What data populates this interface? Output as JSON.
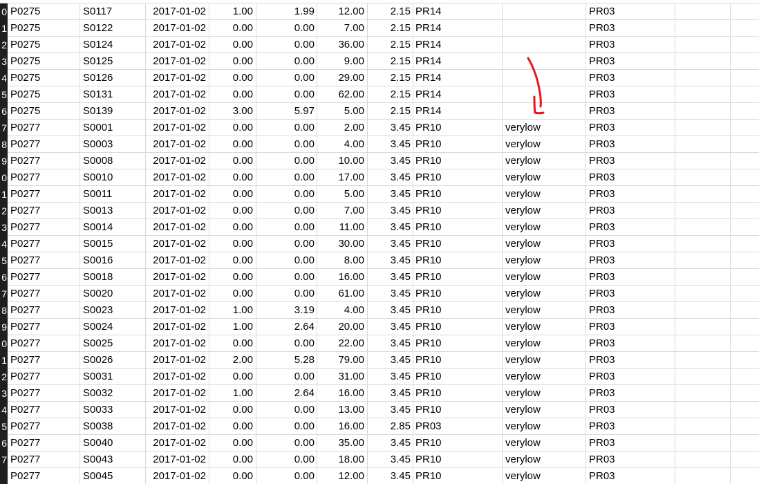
{
  "rows": [
    {
      "num": "0",
      "product": "P0275",
      "store": "S0117",
      "date": "2017-01-02",
      "qty": "1.00",
      "revenue": "1.99",
      "stock": "12.00",
      "price": "2.15",
      "promo": "PR14",
      "level": "",
      "group": "PR03"
    },
    {
      "num": "1",
      "product": "P0275",
      "store": "S0122",
      "date": "2017-01-02",
      "qty": "0.00",
      "revenue": "0.00",
      "stock": "7.00",
      "price": "2.15",
      "promo": "PR14",
      "level": "",
      "group": "PR03"
    },
    {
      "num": "2",
      "product": "P0275",
      "store": "S0124",
      "date": "2017-01-02",
      "qty": "0.00",
      "revenue": "0.00",
      "stock": "36.00",
      "price": "2.15",
      "promo": "PR14",
      "level": "",
      "group": "PR03"
    },
    {
      "num": "3",
      "product": "P0275",
      "store": "S0125",
      "date": "2017-01-02",
      "qty": "0.00",
      "revenue": "0.00",
      "stock": "9.00",
      "price": "2.15",
      "promo": "PR14",
      "level": "",
      "group": "PR03"
    },
    {
      "num": "4",
      "product": "P0275",
      "store": "S0126",
      "date": "2017-01-02",
      "qty": "0.00",
      "revenue": "0.00",
      "stock": "29.00",
      "price": "2.15",
      "promo": "PR14",
      "level": "",
      "group": "PR03"
    },
    {
      "num": "5",
      "product": "P0275",
      "store": "S0131",
      "date": "2017-01-02",
      "qty": "0.00",
      "revenue": "0.00",
      "stock": "62.00",
      "price": "2.15",
      "promo": "PR14",
      "level": "",
      "group": "PR03"
    },
    {
      "num": "6",
      "product": "P0275",
      "store": "S0139",
      "date": "2017-01-02",
      "qty": "3.00",
      "revenue": "5.97",
      "stock": "5.00",
      "price": "2.15",
      "promo": "PR14",
      "level": "",
      "group": "PR03"
    },
    {
      "num": "7",
      "product": "P0277",
      "store": "S0001",
      "date": "2017-01-02",
      "qty": "0.00",
      "revenue": "0.00",
      "stock": "2.00",
      "price": "3.45",
      "promo": "PR10",
      "level": "verylow",
      "group": "PR03"
    },
    {
      "num": "8",
      "product": "P0277",
      "store": "S0003",
      "date": "2017-01-02",
      "qty": "0.00",
      "revenue": "0.00",
      "stock": "4.00",
      "price": "3.45",
      "promo": "PR10",
      "level": "verylow",
      "group": "PR03"
    },
    {
      "num": "9",
      "product": "P0277",
      "store": "S0008",
      "date": "2017-01-02",
      "qty": "0.00",
      "revenue": "0.00",
      "stock": "10.00",
      "price": "3.45",
      "promo": "PR10",
      "level": "verylow",
      "group": "PR03"
    },
    {
      "num": "0",
      "product": "P0277",
      "store": "S0010",
      "date": "2017-01-02",
      "qty": "0.00",
      "revenue": "0.00",
      "stock": "17.00",
      "price": "3.45",
      "promo": "PR10",
      "level": "verylow",
      "group": "PR03"
    },
    {
      "num": "1",
      "product": "P0277",
      "store": "S0011",
      "date": "2017-01-02",
      "qty": "0.00",
      "revenue": "0.00",
      "stock": "5.00",
      "price": "3.45",
      "promo": "PR10",
      "level": "verylow",
      "group": "PR03"
    },
    {
      "num": "2",
      "product": "P0277",
      "store": "S0013",
      "date": "2017-01-02",
      "qty": "0.00",
      "revenue": "0.00",
      "stock": "7.00",
      "price": "3.45",
      "promo": "PR10",
      "level": "verylow",
      "group": "PR03"
    },
    {
      "num": "3",
      "product": "P0277",
      "store": "S0014",
      "date": "2017-01-02",
      "qty": "0.00",
      "revenue": "0.00",
      "stock": "11.00",
      "price": "3.45",
      "promo": "PR10",
      "level": "verylow",
      "group": "PR03"
    },
    {
      "num": "4",
      "product": "P0277",
      "store": "S0015",
      "date": "2017-01-02",
      "qty": "0.00",
      "revenue": "0.00",
      "stock": "30.00",
      "price": "3.45",
      "promo": "PR10",
      "level": "verylow",
      "group": "PR03"
    },
    {
      "num": "5",
      "product": "P0277",
      "store": "S0016",
      "date": "2017-01-02",
      "qty": "0.00",
      "revenue": "0.00",
      "stock": "8.00",
      "price": "3.45",
      "promo": "PR10",
      "level": "verylow",
      "group": "PR03"
    },
    {
      "num": "6",
      "product": "P0277",
      "store": "S0018",
      "date": "2017-01-02",
      "qty": "0.00",
      "revenue": "0.00",
      "stock": "16.00",
      "price": "3.45",
      "promo": "PR10",
      "level": "verylow",
      "group": "PR03"
    },
    {
      "num": "7",
      "product": "P0277",
      "store": "S0020",
      "date": "2017-01-02",
      "qty": "0.00",
      "revenue": "0.00",
      "stock": "61.00",
      "price": "3.45",
      "promo": "PR10",
      "level": "verylow",
      "group": "PR03"
    },
    {
      "num": "8",
      "product": "P0277",
      "store": "S0023",
      "date": "2017-01-02",
      "qty": "1.00",
      "revenue": "3.19",
      "stock": "4.00",
      "price": "3.45",
      "promo": "PR10",
      "level": "verylow",
      "group": "PR03"
    },
    {
      "num": "9",
      "product": "P0277",
      "store": "S0024",
      "date": "2017-01-02",
      "qty": "1.00",
      "revenue": "2.64",
      "stock": "20.00",
      "price": "3.45",
      "promo": "PR10",
      "level": "verylow",
      "group": "PR03"
    },
    {
      "num": "0",
      "product": "P0277",
      "store": "S0025",
      "date": "2017-01-02",
      "qty": "0.00",
      "revenue": "0.00",
      "stock": "22.00",
      "price": "3.45",
      "promo": "PR10",
      "level": "verylow",
      "group": "PR03"
    },
    {
      "num": "1",
      "product": "P0277",
      "store": "S0026",
      "date": "2017-01-02",
      "qty": "2.00",
      "revenue": "5.28",
      "stock": "79.00",
      "price": "3.45",
      "promo": "PR10",
      "level": "verylow",
      "group": "PR03"
    },
    {
      "num": "2",
      "product": "P0277",
      "store": "S0031",
      "date": "2017-01-02",
      "qty": "0.00",
      "revenue": "0.00",
      "stock": "31.00",
      "price": "3.45",
      "promo": "PR10",
      "level": "verylow",
      "group": "PR03"
    },
    {
      "num": "3",
      "product": "P0277",
      "store": "S0032",
      "date": "2017-01-02",
      "qty": "1.00",
      "revenue": "2.64",
      "stock": "16.00",
      "price": "3.45",
      "promo": "PR10",
      "level": "verylow",
      "group": "PR03"
    },
    {
      "num": "4",
      "product": "P0277",
      "store": "S0033",
      "date": "2017-01-02",
      "qty": "0.00",
      "revenue": "0.00",
      "stock": "13.00",
      "price": "3.45",
      "promo": "PR10",
      "level": "verylow",
      "group": "PR03"
    },
    {
      "num": "5",
      "product": "P0277",
      "store": "S0038",
      "date": "2017-01-02",
      "qty": "0.00",
      "revenue": "0.00",
      "stock": "16.00",
      "price": "2.85",
      "promo": "PR03",
      "level": "verylow",
      "group": "PR03"
    },
    {
      "num": "6",
      "product": "P0277",
      "store": "S0040",
      "date": "2017-01-02",
      "qty": "0.00",
      "revenue": "0.00",
      "stock": "35.00",
      "price": "3.45",
      "promo": "PR10",
      "level": "verylow",
      "group": "PR03"
    },
    {
      "num": "7",
      "product": "P0277",
      "store": "S0043",
      "date": "2017-01-02",
      "qty": "0.00",
      "revenue": "0.00",
      "stock": "18.00",
      "price": "3.45",
      "promo": "PR10",
      "level": "verylow",
      "group": "PR03"
    },
    {
      "num": "",
      "product": "P0277",
      "store": "S0045",
      "date": "2017-01-02",
      "qty": "0.00",
      "revenue": "0.00",
      "stock": "12.00",
      "price": "3.45",
      "promo": "PR10",
      "level": "verylow",
      "group": "PR03"
    }
  ],
  "annotation": {
    "icon": "hand-drawn-arrow-icon",
    "color": "#e8141c"
  },
  "colors": {
    "row_header_bg": "#1f1f1f",
    "gridline": "#d9d9d9"
  }
}
